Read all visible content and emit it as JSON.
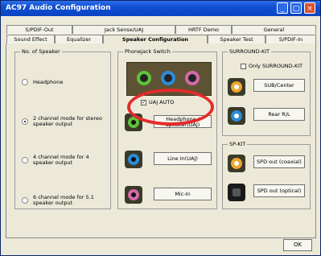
{
  "window": {
    "title": "AC97 Audio Configuration"
  },
  "tabs": {
    "top": [
      "S/PDIF-Out",
      "Jack Sense/UAJ",
      "HRTF Demo",
      "General"
    ],
    "bottom": [
      "Sound Effect",
      "Equalizer",
      "Speaker Configuration",
      "Speaker Test",
      "S/PDIF-In"
    ],
    "active": "Speaker Configuration"
  },
  "speaker_group": {
    "label": "No. of Speaker",
    "options": [
      {
        "label": "Headphone"
      },
      {
        "label": "2 channel mode for stereo speaker output",
        "selected": true
      },
      {
        "label": "4 channel mode for 4 speaker output"
      },
      {
        "label": "6 channel mode for 5.1 speaker output"
      }
    ]
  },
  "phonejack_group": {
    "label": "Phonejack Switch",
    "uaj_auto": {
      "label": "UAJ AUTO",
      "checked": true
    },
    "buttons": [
      "Headphone / Speaker(UAJ)",
      "Line In(UAJ)",
      "Mic-In"
    ],
    "colors": {
      "lime": "#5ec33a",
      "blue": "#2c8bd6",
      "pink": "#d16aa8"
    }
  },
  "surround_group": {
    "label": "SURROUND-KIT",
    "only_label": "Only SURROUND-KIT",
    "buttons": [
      "SUB/Center",
      "Rear R/L"
    ],
    "colors": {
      "orange": "#f0a62f",
      "blue": "#2c8bd6"
    }
  },
  "spkit_group": {
    "label": "SP-KIT",
    "buttons": [
      "SPD out (coaxial)",
      "SPD out (optical)"
    ]
  },
  "footer": {
    "ok_label": "OK"
  },
  "annotation": {
    "color": "#e52b2b"
  }
}
